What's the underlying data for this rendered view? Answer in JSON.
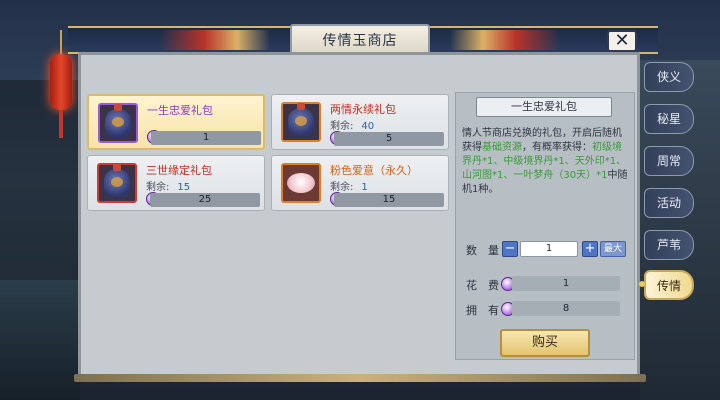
{
  "window": {
    "title": "传情玉商店",
    "close_label": "✕"
  },
  "items": [
    {
      "name": "一生忠爱礼包",
      "price": "1",
      "name_color": "#8a3ac7",
      "frame": "purple",
      "selected": true
    },
    {
      "name": "两情永续礼包",
      "remain_label": "剩余:",
      "remain": "40",
      "price": "5",
      "name_color": "#c62b22",
      "frame": "orange",
      "selected": false
    },
    {
      "name": "三世缘定礼包",
      "remain_label": "剩余:",
      "remain": "15",
      "price": "25",
      "name_color": "#c62b22",
      "frame": "red",
      "selected": false
    },
    {
      "name": "粉色爱意（永久）",
      "remain_label": "剩余:",
      "remain": "1",
      "price": "15",
      "name_color": "#d26316",
      "frame": "orange",
      "selected": false
    }
  ],
  "detail": {
    "title": "一生忠爱礼包",
    "desc_part1": "情人节商店兑换的礼包，开启后随机获得",
    "desc_highlight1": "基础资源",
    "desc_part2": "，有概率获得：",
    "desc_highlight2": "初级境界丹*1、中级境界丹*1、天外印*1、山河图*1、一叶梦舟（30天）*1",
    "desc_part3": "中随机1种。",
    "qty_label": "数　量",
    "qty_minus": "−",
    "qty_value": "1",
    "qty_plus": "+",
    "qty_max": "最大",
    "cost_label": "花　费",
    "cost_value": "1",
    "own_label": "拥　有",
    "own_value": "8",
    "buy_label": "购买"
  },
  "tabs": [
    {
      "label": "侠义",
      "active": false
    },
    {
      "label": "秘星",
      "active": false
    },
    {
      "label": "周常",
      "active": false
    },
    {
      "label": "活动",
      "active": false
    },
    {
      "label": "芦苇",
      "active": false
    },
    {
      "label": "传情",
      "active": true
    }
  ],
  "colors": {
    "accent_gold": "#d7b56c",
    "highlight_green": "#3b9a3c",
    "remain_blue": "#2d5ea8"
  }
}
